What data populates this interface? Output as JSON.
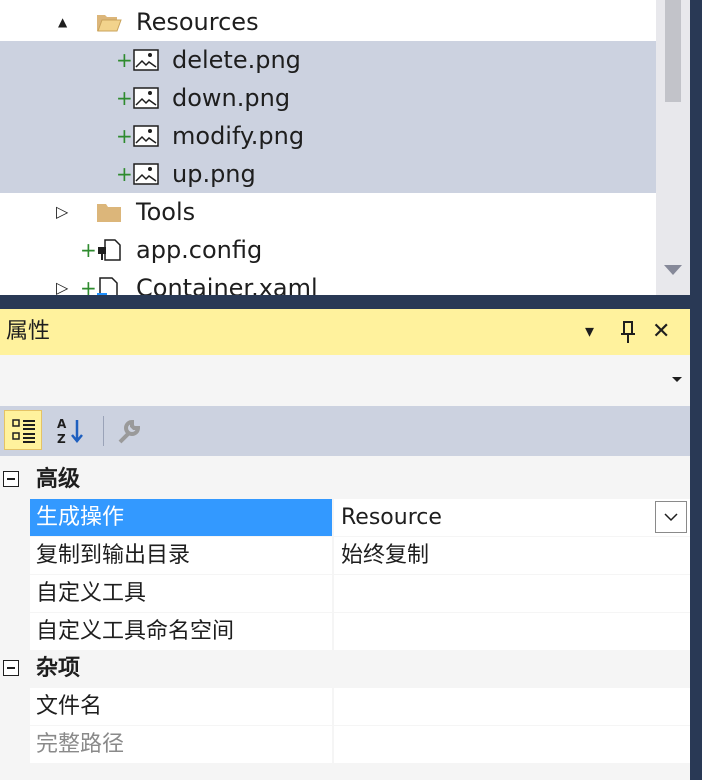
{
  "tree": {
    "items": [
      {
        "label": "Resources",
        "icon": "folder-open-icon",
        "expand": "▲"
      },
      {
        "label": "delete.png",
        "icon": "image-file-icon",
        "added": "+"
      },
      {
        "label": "down.png",
        "icon": "image-file-icon",
        "added": "+"
      },
      {
        "label": "modify.png",
        "icon": "image-file-icon",
        "added": "+"
      },
      {
        "label": "up.png",
        "icon": "image-file-icon",
        "added": "+"
      },
      {
        "label": "Tools",
        "icon": "folder-icon",
        "expand": "▷"
      },
      {
        "label": "app.config",
        "icon": "config-file-icon",
        "added": "+"
      },
      {
        "label": "Container.xaml",
        "icon": "xaml-file-icon",
        "added": "+",
        "expand": "▷"
      }
    ]
  },
  "properties": {
    "title": "属性",
    "controls": {
      "dropdown": "▾",
      "pin": "⊥",
      "close": "✕"
    },
    "categories": [
      {
        "name": "高级",
        "rows": [
          {
            "name": "生成操作",
            "value": "Resource"
          },
          {
            "name": "复制到输出目录",
            "value": "始终复制"
          },
          {
            "name": "自定义工具",
            "value": ""
          },
          {
            "name": "自定义工具命名空间",
            "value": ""
          }
        ]
      },
      {
        "name": "杂项",
        "rows": [
          {
            "name": "文件名",
            "value": ""
          },
          {
            "name": "完整路径",
            "value": ""
          }
        ]
      }
    ]
  },
  "colors": {
    "selection_gray": "#ccd2e0",
    "title_yellow": "#fff29d",
    "selection_blue": "#3399ff",
    "frame_dark": "#293955"
  }
}
